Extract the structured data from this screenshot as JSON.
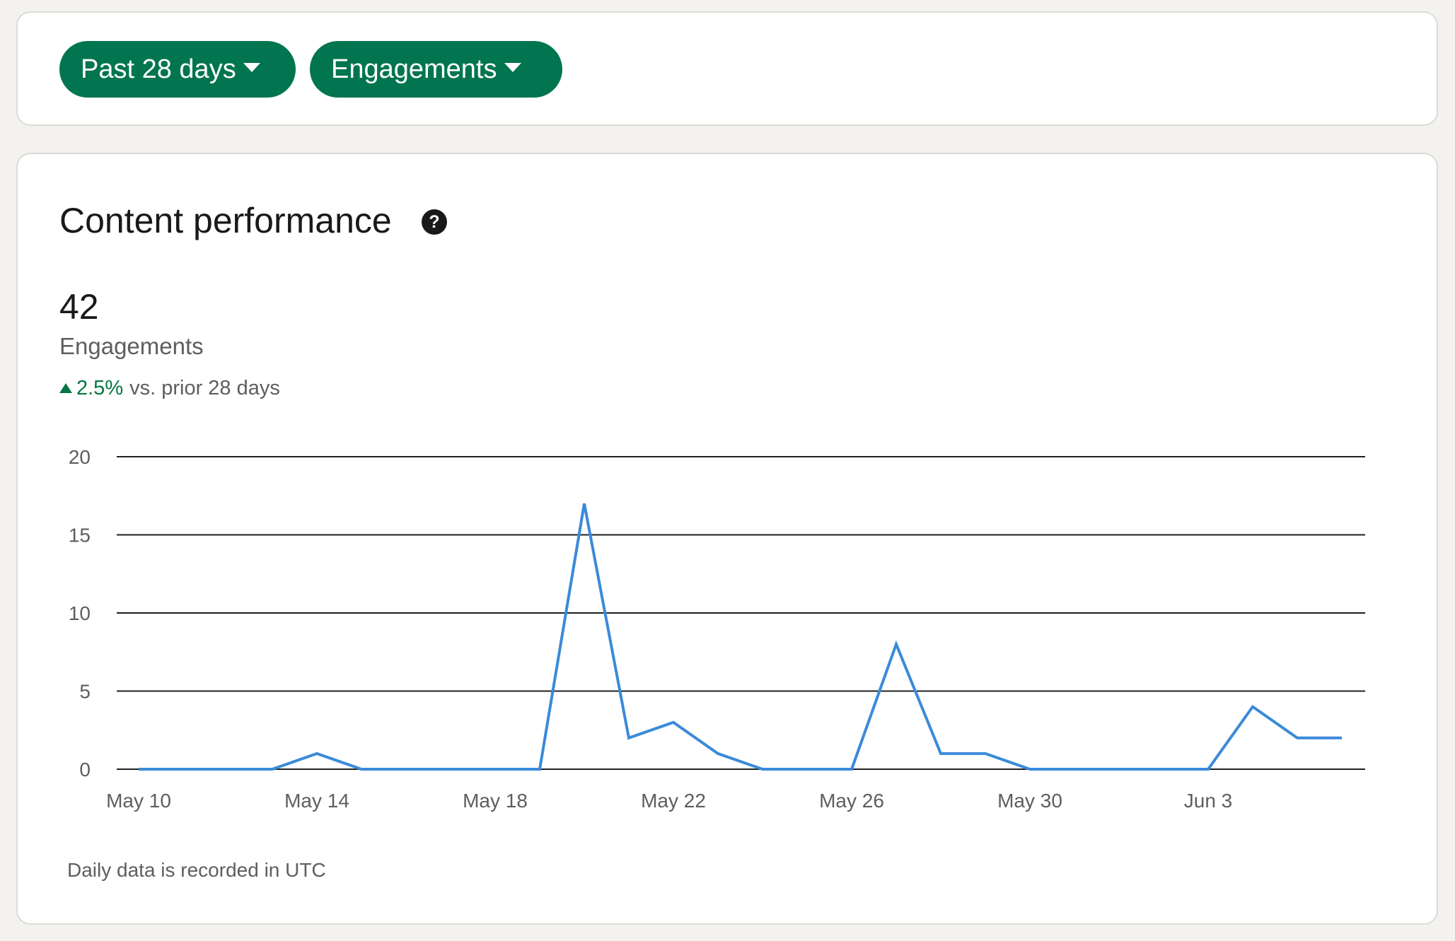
{
  "filters": {
    "range_label": "Past 28 days",
    "metric_label": "Engagements"
  },
  "performance": {
    "title": "Content performance",
    "total_value": "42",
    "metric_name": "Engagements",
    "change_pct": "2.5%",
    "change_direction": "up",
    "change_comparison": "vs. prior 28 days",
    "footnote": "Daily data is recorded in UTC"
  },
  "colors": {
    "accent_green": "#01754f",
    "change_green": "#057642",
    "line_blue": "#3b8ad9"
  },
  "chart_data": {
    "type": "line",
    "x": [
      "May 10",
      "May 11",
      "May 12",
      "May 13",
      "May 14",
      "May 15",
      "May 16",
      "May 17",
      "May 18",
      "May 19",
      "May 20",
      "May 21",
      "May 22",
      "May 23",
      "May 24",
      "May 25",
      "May 26",
      "May 27",
      "May 28",
      "May 29",
      "May 30",
      "May 31",
      "Jun 1",
      "Jun 2",
      "Jun 3",
      "Jun 4",
      "Jun 5",
      "Jun 6"
    ],
    "series": [
      {
        "values": [
          0,
          0,
          0,
          0,
          1,
          0,
          0,
          0,
          0,
          0,
          17,
          2,
          3,
          1,
          0,
          0,
          0,
          8,
          1,
          1,
          0,
          0,
          0,
          0,
          0,
          4,
          2,
          2
        ]
      }
    ],
    "x_tick_labels": [
      "May 10",
      "May 14",
      "May 18",
      "May 22",
      "May 26",
      "May 30",
      "Jun 3"
    ],
    "y_tick_labels": [
      "0",
      "5",
      "10",
      "15",
      "20"
    ],
    "ylim": [
      0,
      20
    ],
    "grid": true
  }
}
